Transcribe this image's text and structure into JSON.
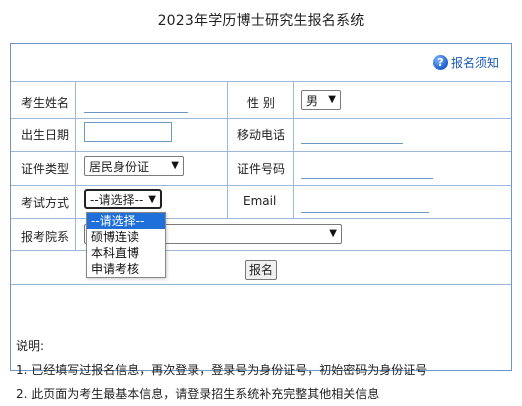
{
  "page": {
    "title": "2023年学历博士研究生报名系统"
  },
  "notice": {
    "label": "报名须知",
    "icon": "help-circle-icon"
  },
  "form": {
    "name_label": "考生姓名",
    "name_value": "",
    "gender_label": "性 别",
    "gender_value": "男",
    "birth_label": "出生日期",
    "birth_value": "",
    "phone_label": "移动电话",
    "phone_value": "",
    "id_type_label": "证件类型",
    "id_type_value": "居民身份证",
    "id_number_label": "证件号码",
    "id_number_value": "",
    "exam_mode_label": "考试方式",
    "exam_mode_value": "--请选择--",
    "email_label": "Email",
    "email_value": "",
    "school_label": "报考院系",
    "school_value": "",
    "submit_label": "报名"
  },
  "exam_mode_options": [
    "--请选择--",
    "硕博连读",
    "本科直博",
    "申请考核"
  ],
  "notes": {
    "heading": "说明:",
    "items": [
      "1. 已经填写过报名信息，再次登录，登录号为身份证号，初始密码为身份证号",
      "2. 此页面为考生最基本信息，请登录招生系统补充完整其他相关信息"
    ]
  },
  "colors": {
    "border": "#6f97c6",
    "link": "#1a5bb5",
    "selected": "#1e6fd9"
  }
}
